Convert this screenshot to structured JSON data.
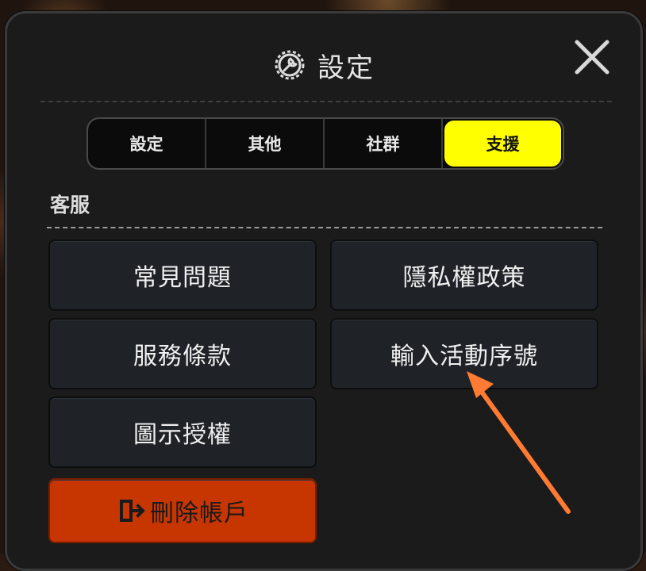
{
  "header": {
    "title": "設定",
    "icon": "gear-wrench-icon",
    "close_icon": "close-icon"
  },
  "tabs": [
    {
      "label": "設定",
      "active": false
    },
    {
      "label": "其他",
      "active": false
    },
    {
      "label": "社群",
      "active": false
    },
    {
      "label": "支援",
      "active": true
    }
  ],
  "section": {
    "label": "客服"
  },
  "buttons": {
    "faq": "常見問題",
    "privacy": "隱私權政策",
    "terms": "服務條款",
    "redeem": "輸入活動序號",
    "icon_license": "圖示授權",
    "delete_account": "刪除帳戶"
  },
  "colors": {
    "active_tab": "#ffff00",
    "danger_button": "#c73600",
    "arrow": "#ff7a33"
  }
}
